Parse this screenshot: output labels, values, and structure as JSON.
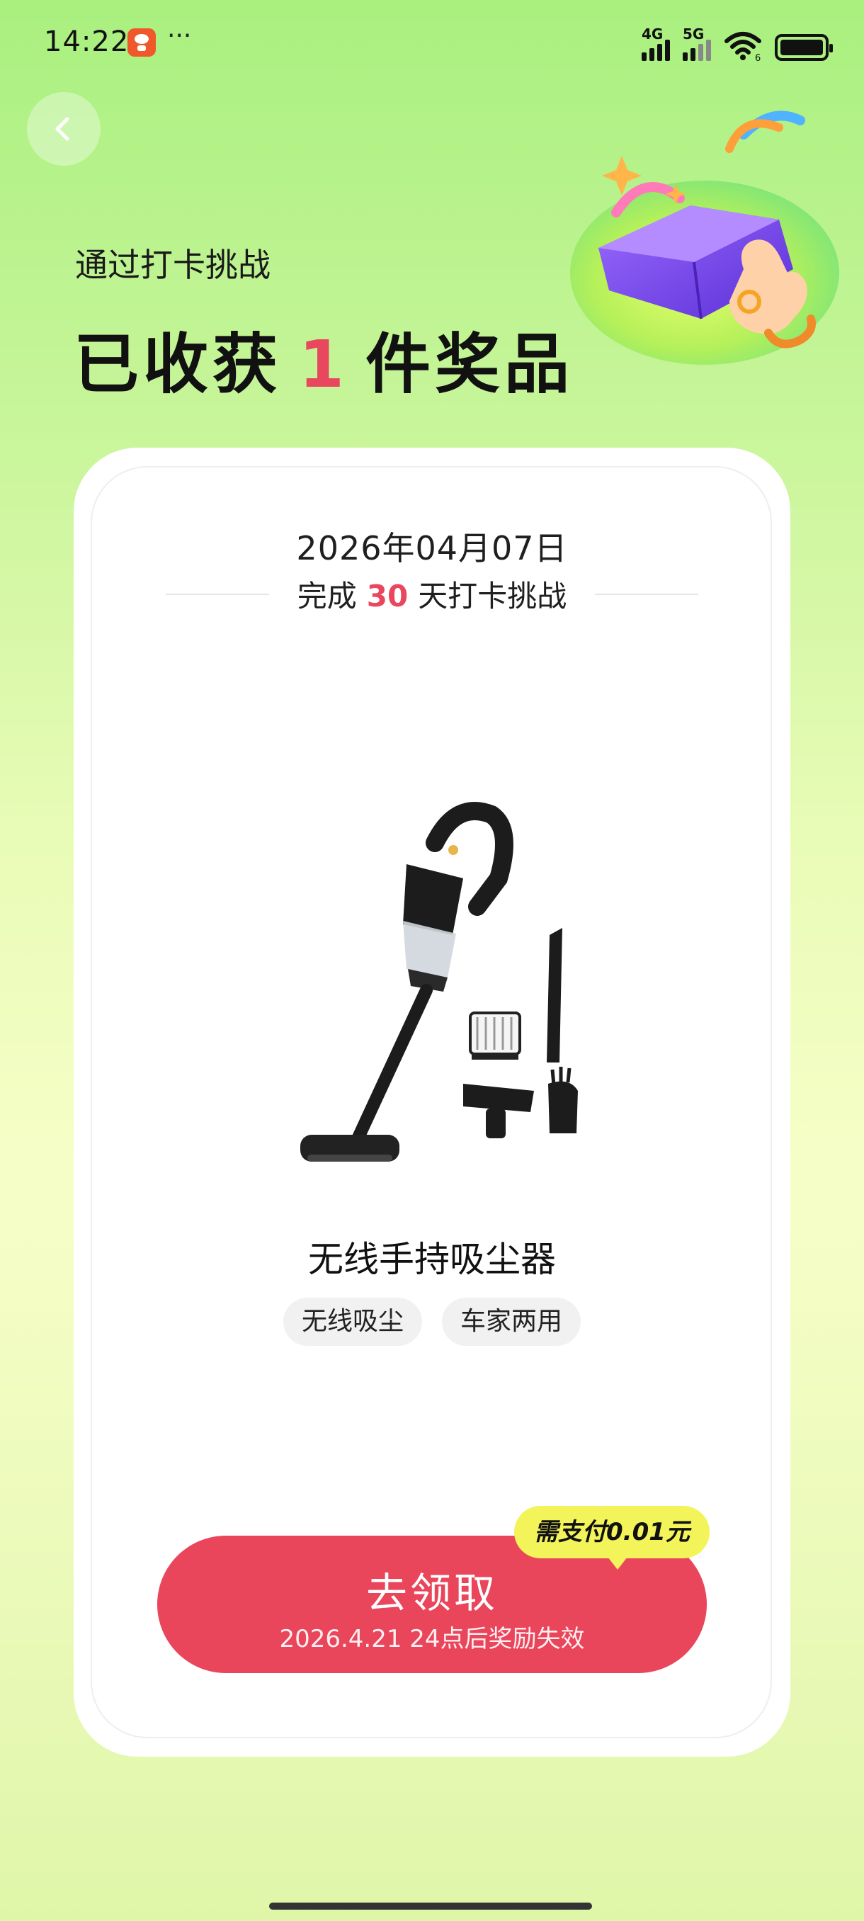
{
  "status_bar": {
    "time": "14:22",
    "more": "···",
    "network_1": "4G",
    "network_2": "5G",
    "wifi_sub": "6"
  },
  "header": {
    "subtitle": "通过打卡挑战",
    "title_prefix": "已收获",
    "prize_count": "1",
    "title_suffix": "件奖品"
  },
  "card": {
    "date": "2026年04月07日",
    "challenge_prefix": "完成",
    "challenge_days": "30",
    "challenge_suffix": "天打卡挑战",
    "product_name": "无线手持吸尘器",
    "tags": [
      "无线吸尘",
      "车家两用"
    ],
    "cta_label": "去领取",
    "cta_expiry": "2026.4.21 24点后奖励失效",
    "pay_badge": "需支付0.01元"
  },
  "colors": {
    "accent": "#e9455b",
    "badge": "#f3f35a",
    "bg_top": "#a9f07f",
    "bg_mid": "#f6fec8"
  },
  "icons": [
    "back-chevron-icon",
    "gift-box-icon",
    "wifi-icon",
    "battery-icon",
    "signal-icon",
    "app-notification-icon"
  ]
}
